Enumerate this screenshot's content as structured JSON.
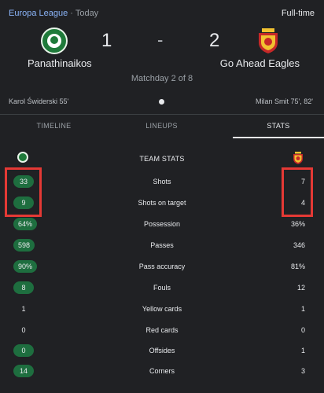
{
  "header": {
    "league": "Europa League",
    "separator": "·",
    "date": "Today",
    "status": "Full-time",
    "matchday": "Matchday 2 of 8"
  },
  "home_team": {
    "name": "Panathinaikos",
    "score": "1",
    "scorers": "Karol Świderski 55'"
  },
  "away_team": {
    "name": "Go Ahead Eagles",
    "score": "2",
    "scorers": "Milan Smit 75', 82'"
  },
  "score_dash": "-",
  "tabs": [
    {
      "label": "TIMELINE"
    },
    {
      "label": "LINEUPS"
    },
    {
      "label": "STATS"
    }
  ],
  "active_tab": "STATS",
  "stats": {
    "title": "TEAM STATS",
    "rows": [
      {
        "label": "Shots",
        "home": "33",
        "away": "7",
        "home_highlighted": true
      },
      {
        "label": "Shots on target",
        "home": "9",
        "away": "4",
        "home_highlighted": true
      },
      {
        "label": "Possession",
        "home": "64%",
        "away": "36%",
        "home_highlighted": true
      },
      {
        "label": "Passes",
        "home": "598",
        "away": "346",
        "home_highlighted": true
      },
      {
        "label": "Pass accuracy",
        "home": "90%",
        "away": "81%",
        "home_highlighted": true
      },
      {
        "label": "Fouls",
        "home": "8",
        "away": "12",
        "home_highlighted": true
      },
      {
        "label": "Yellow cards",
        "home": "1",
        "away": "1",
        "home_highlighted": false
      },
      {
        "label": "Red cards",
        "home": "0",
        "away": "0",
        "home_highlighted": false
      },
      {
        "label": "Offsides",
        "home": "0",
        "away": "1",
        "home_highlighted": true
      },
      {
        "label": "Corners",
        "home": "14",
        "away": "3",
        "home_highlighted": true
      }
    ]
  },
  "colors": {
    "background": "#202124",
    "link": "#8ab4f8",
    "pill_green": "#1e6e3f",
    "annotation_red": "#e53935"
  },
  "icons": {
    "home_crest": "panathinaikos-crest-icon",
    "away_crest": "go-ahead-eagles-crest-icon",
    "goal": "football-icon"
  }
}
